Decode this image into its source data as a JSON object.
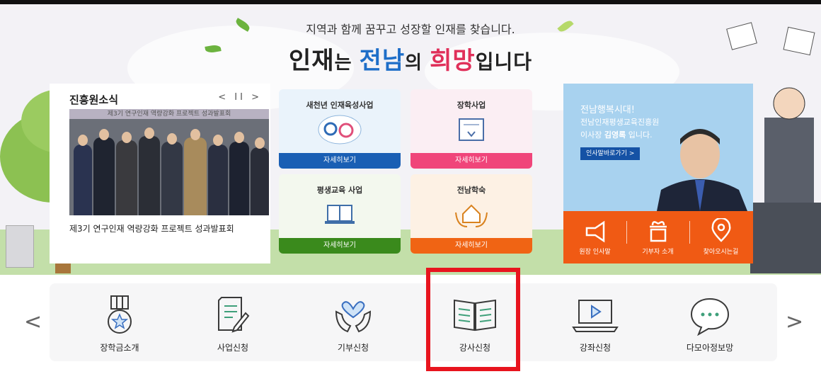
{
  "hero": {
    "subtitle": "지역과 함께 꿈꾸고 성장할 인재를 찾습니다.",
    "title_part1": "인재",
    "title_part2": "는 ",
    "title_part3": "전남",
    "title_part4": "의 ",
    "title_part5": "희망",
    "title_part6": "입니다"
  },
  "news": {
    "heading": "진흥원소식",
    "controls": "< II >",
    "photo_banner": "제3기 연구인재 역량강화 프로젝트 성과발표회",
    "caption": "제3기 연구인재 역량강화 프로젝트 성과발표회"
  },
  "cards": [
    {
      "label": "새천년 인재육성사업",
      "button": "자세히보기",
      "color": "#1a5fb4"
    },
    {
      "label": "장학사업",
      "button": "자세히보기",
      "color": "#f0457a"
    },
    {
      "label": "평생교육 사업",
      "button": "자세히보기",
      "color": "#3a8a1c"
    },
    {
      "label": "전남학숙",
      "button": "자세히보기",
      "color": "#f06414"
    }
  ],
  "promo": {
    "line1": "전남행복시대!",
    "line2": "전남인재평생교육진흥원",
    "line3_prefix": "이사장 ",
    "line3_name": "김영록",
    "line3_suffix": " 입니다.",
    "link": "인사말바로가기 >",
    "items": [
      {
        "label": "원장 인사말",
        "icon": "megaphone-icon"
      },
      {
        "label": "기부자 소개",
        "icon": "gift-icon"
      },
      {
        "label": "찾아오시는길",
        "icon": "map-pin-icon"
      }
    ]
  },
  "quick_menu": {
    "prev": "<",
    "next": ">",
    "items": [
      {
        "label": "장학금소개",
        "icon": "medal-icon"
      },
      {
        "label": "사업신청",
        "icon": "document-pen-icon"
      },
      {
        "label": "기부신청",
        "icon": "hands-heart-icon"
      },
      {
        "label": "강사신청",
        "icon": "open-book-icon"
      },
      {
        "label": "강좌신청",
        "icon": "video-laptop-icon"
      },
      {
        "label": "다모아정보망",
        "icon": "chat-bubble-icon"
      }
    ]
  }
}
